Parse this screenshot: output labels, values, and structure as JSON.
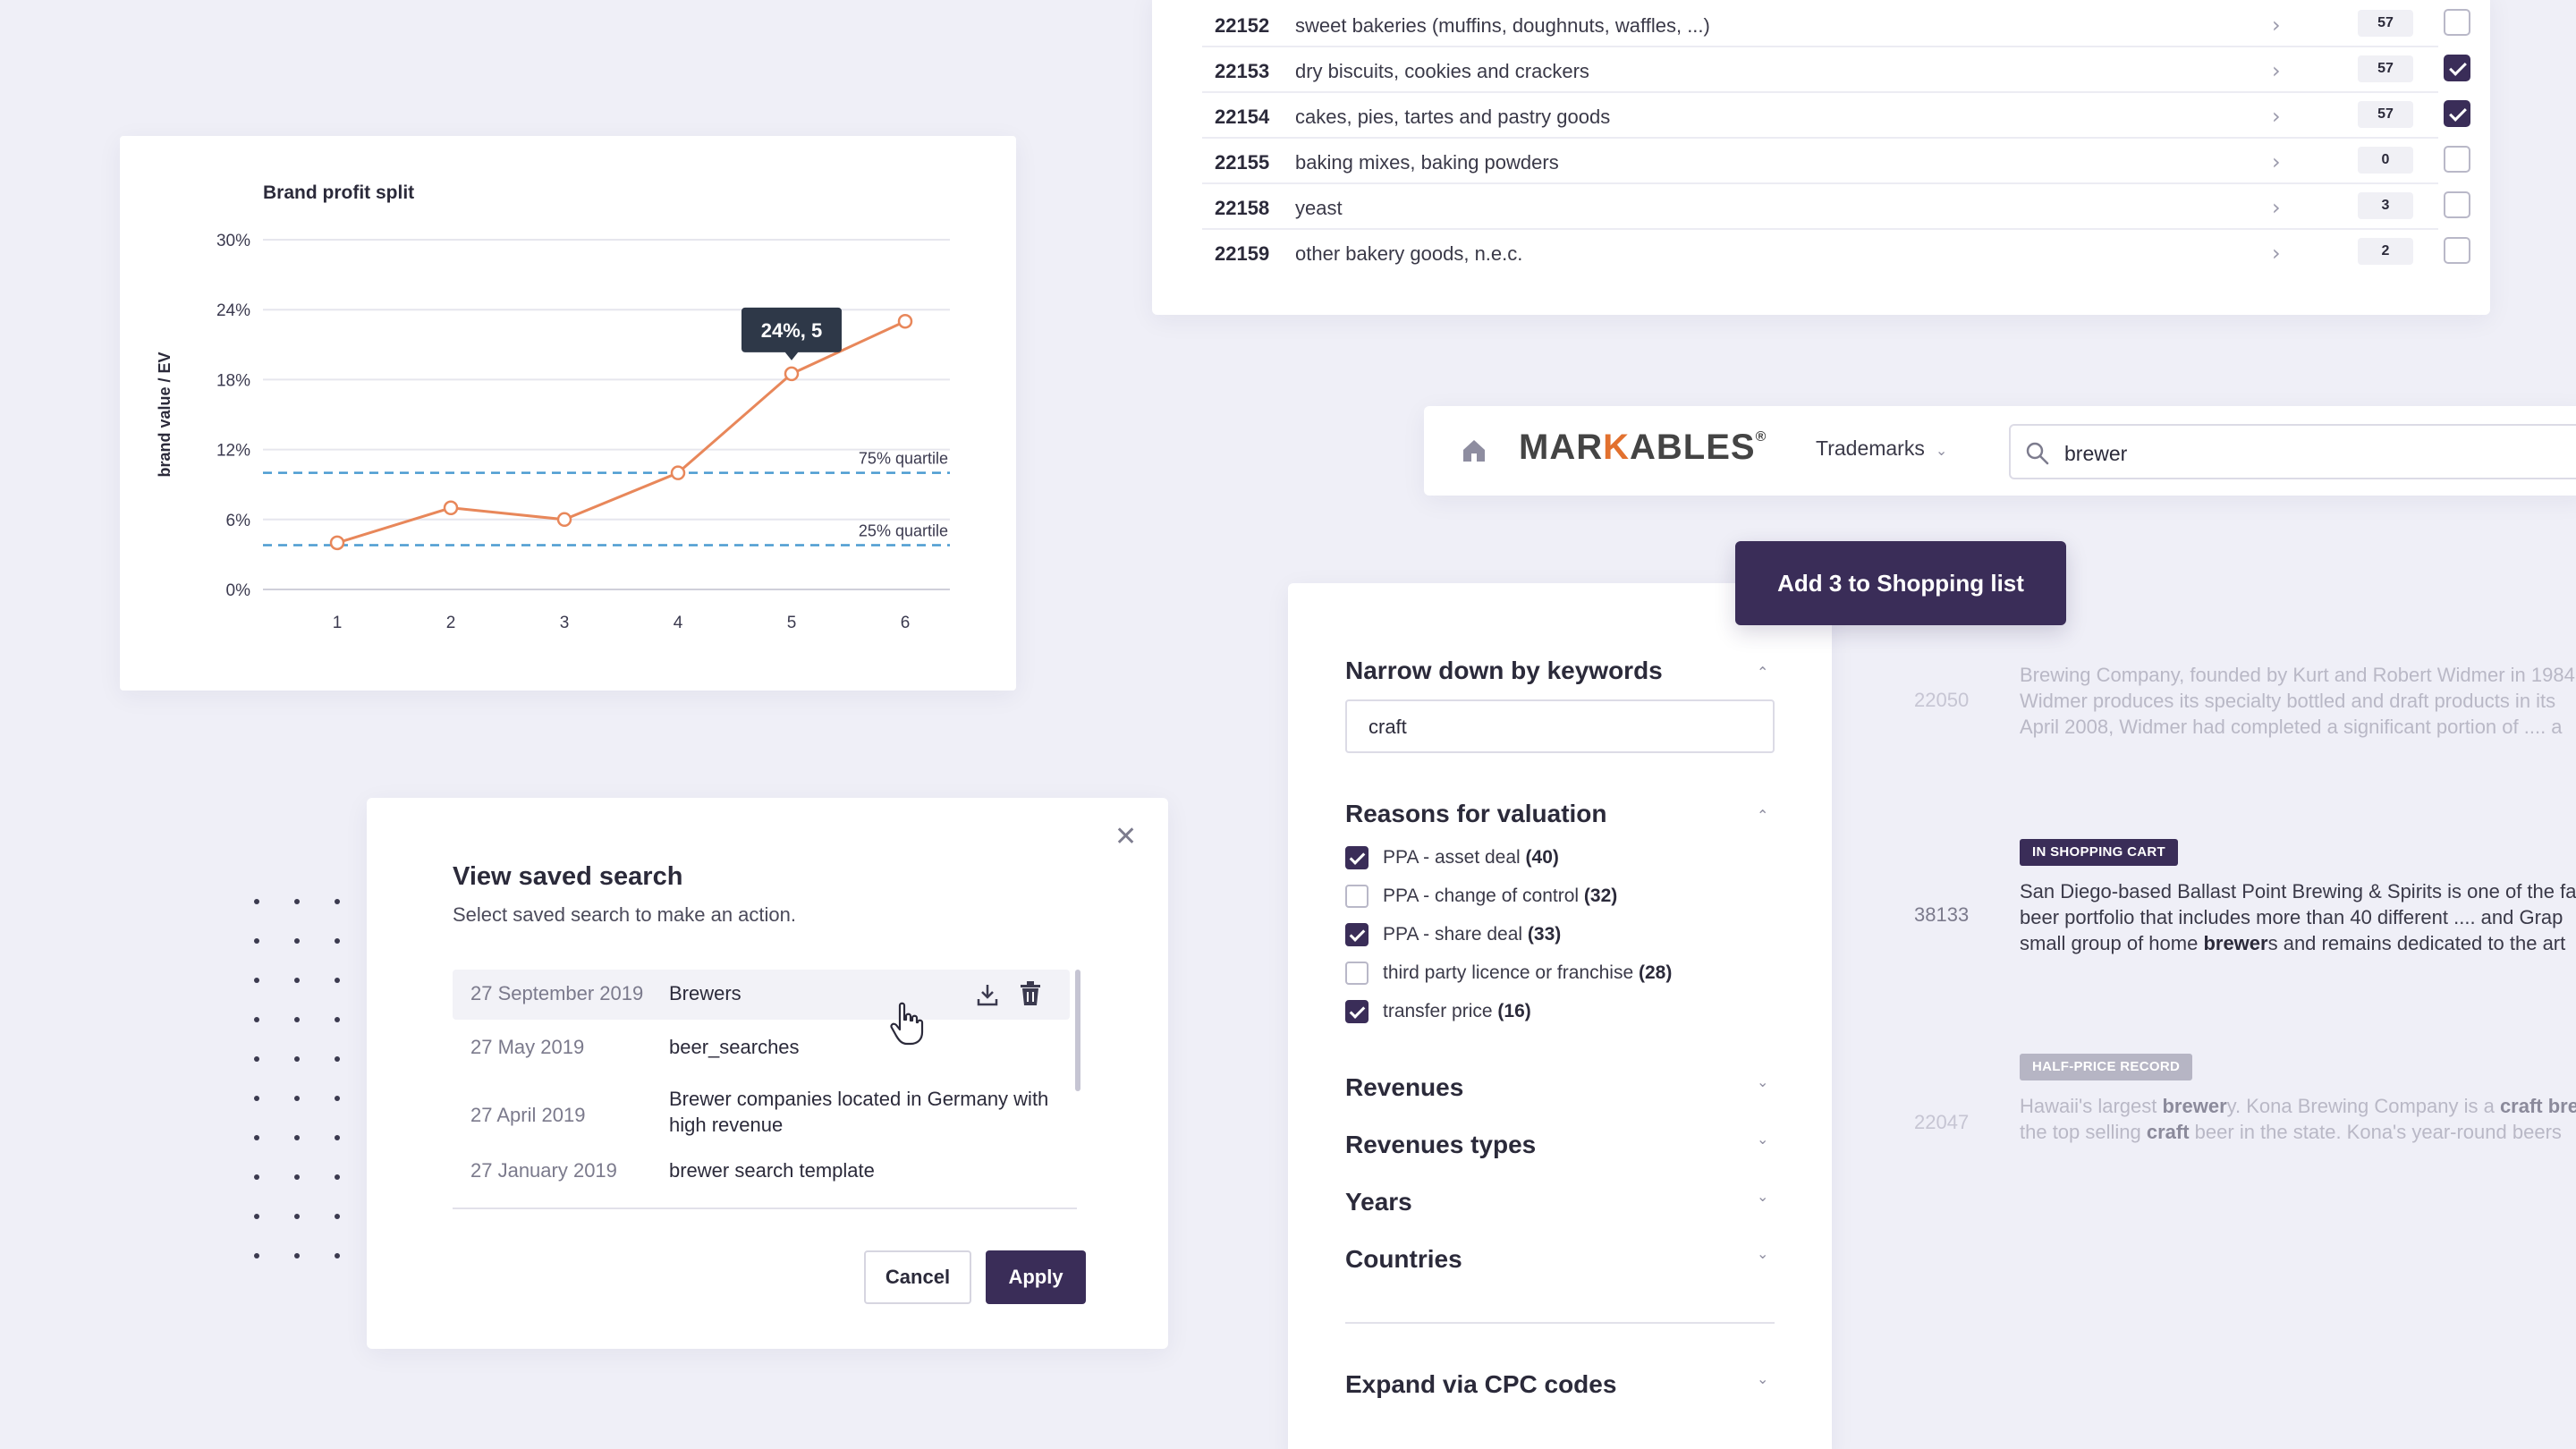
{
  "colors": {
    "background": "#efeff7",
    "accent": "#3a2d58",
    "chart_line": "#e8875a",
    "quartile_line": "#4a9bd1",
    "brand_orange": "#e2712f",
    "badge_cart": "#3a2d58",
    "badge_halfprice": "#b6b5c4"
  },
  "chart_data": {
    "type": "line",
    "title": "Brand profit split",
    "xlabel": "",
    "ylabel": "brand value / EV",
    "x": [
      1,
      2,
      3,
      4,
      5,
      6
    ],
    "series": [
      {
        "values": [
          4,
          7,
          6,
          10,
          18.5,
          23
        ]
      }
    ],
    "ylim": [
      0,
      30
    ],
    "yticks": [
      "0%",
      "6%",
      "12%",
      "18%",
      "24%",
      "30%"
    ],
    "grid": true,
    "reference_lines": [
      {
        "label": "75% quartile",
        "value": 10
      },
      {
        "label": "25% quartile",
        "value": 3.8
      }
    ],
    "tooltip": {
      "text": "24%, 5",
      "x": 5
    }
  },
  "categories": [
    {
      "code": "22152",
      "label": "sweet bakeries (muffins, doughnuts, waffles, ...)",
      "count": "57",
      "checked": false
    },
    {
      "code": "22153",
      "label": "dry biscuits, cookies and crackers",
      "count": "57",
      "checked": true
    },
    {
      "code": "22154",
      "label": "cakes, pies, tartes and pastry goods",
      "count": "57",
      "checked": true
    },
    {
      "code": "22155",
      "label": "baking mixes, baking powders",
      "count": "0",
      "checked": false
    },
    {
      "code": "22158",
      "label": "yeast",
      "count": "3",
      "checked": false
    },
    {
      "code": "22159",
      "label": "other bakery goods, n.e.c.",
      "count": "2",
      "checked": false
    }
  ],
  "header": {
    "logo_part1": "MAR",
    "logo_k": "K",
    "logo_part2": "ABLES",
    "logo_reg": "®",
    "nav_trademarks": "Trademarks",
    "search_value": "brewer"
  },
  "add_shopping_label": "Add 3 to Shopping list",
  "filters": {
    "keywords_title": "Narrow down by keywords",
    "keywords_value": "craft",
    "reasons_title": "Reasons for valuation",
    "reasons": [
      {
        "label": "PPA - asset deal",
        "count": "(40)",
        "checked": true
      },
      {
        "label": "PPA - change of control",
        "count": "(32)",
        "checked": false
      },
      {
        "label": "PPA - share deal",
        "count": "(33)",
        "checked": true
      },
      {
        "label": "third party licence or franchise",
        "count": "(28)",
        "checked": false
      },
      {
        "label": "transfer price",
        "count": "(16)",
        "checked": true
      }
    ],
    "revenues": "Revenues",
    "revenue_types": "Revenues types",
    "years": "Years",
    "countries": "Countries",
    "cpc": "Expand via CPC codes"
  },
  "results": [
    {
      "id": "22050",
      "lines": [
        "Brewing Company, founded by Kurt and Robert Widmer in 1984",
        "Widmer produces its specialty bottled and draft products in its",
        "April 2008, Widmer had completed a significant portion of .... a"
      ]
    },
    {
      "id": "38133",
      "badge": "IN SHOPPING CART",
      "lines": [
        "San Diego-based Ballast Point Brewing & Spirits is one of the fa",
        "beer portfolio that includes more than 40 different .... and Grap"
      ],
      "line3_pre": "small group of home ",
      "line3_bold": "brewer",
      "line3_post": "s and remains dedicated to the art"
    },
    {
      "id": "22047",
      "badge": "HALF-PRICE RECORD",
      "line1_pre": "Hawaii's largest ",
      "line1_bold1": "brewer",
      "line1_mid": "y. Kona Brewing Company is a ",
      "line1_bold2": "craft bre",
      "line2_pre": "the top selling ",
      "line2_bold": "craft",
      "line2_post": " beer in the state. Kona's year-round beers"
    }
  ],
  "modal": {
    "title": "View saved search",
    "subtitle": "Select saved search to make an action.",
    "rows": [
      {
        "date": "27 September 2019",
        "name": "Brewers"
      },
      {
        "date": "27 May 2019",
        "name": "beer_searches"
      },
      {
        "date": "27 April 2019",
        "name": "Brewer companies located in Germany with high revenue"
      },
      {
        "date": "27 January 2019",
        "name": "brewer search template"
      }
    ],
    "cancel": "Cancel",
    "apply": "Apply"
  }
}
